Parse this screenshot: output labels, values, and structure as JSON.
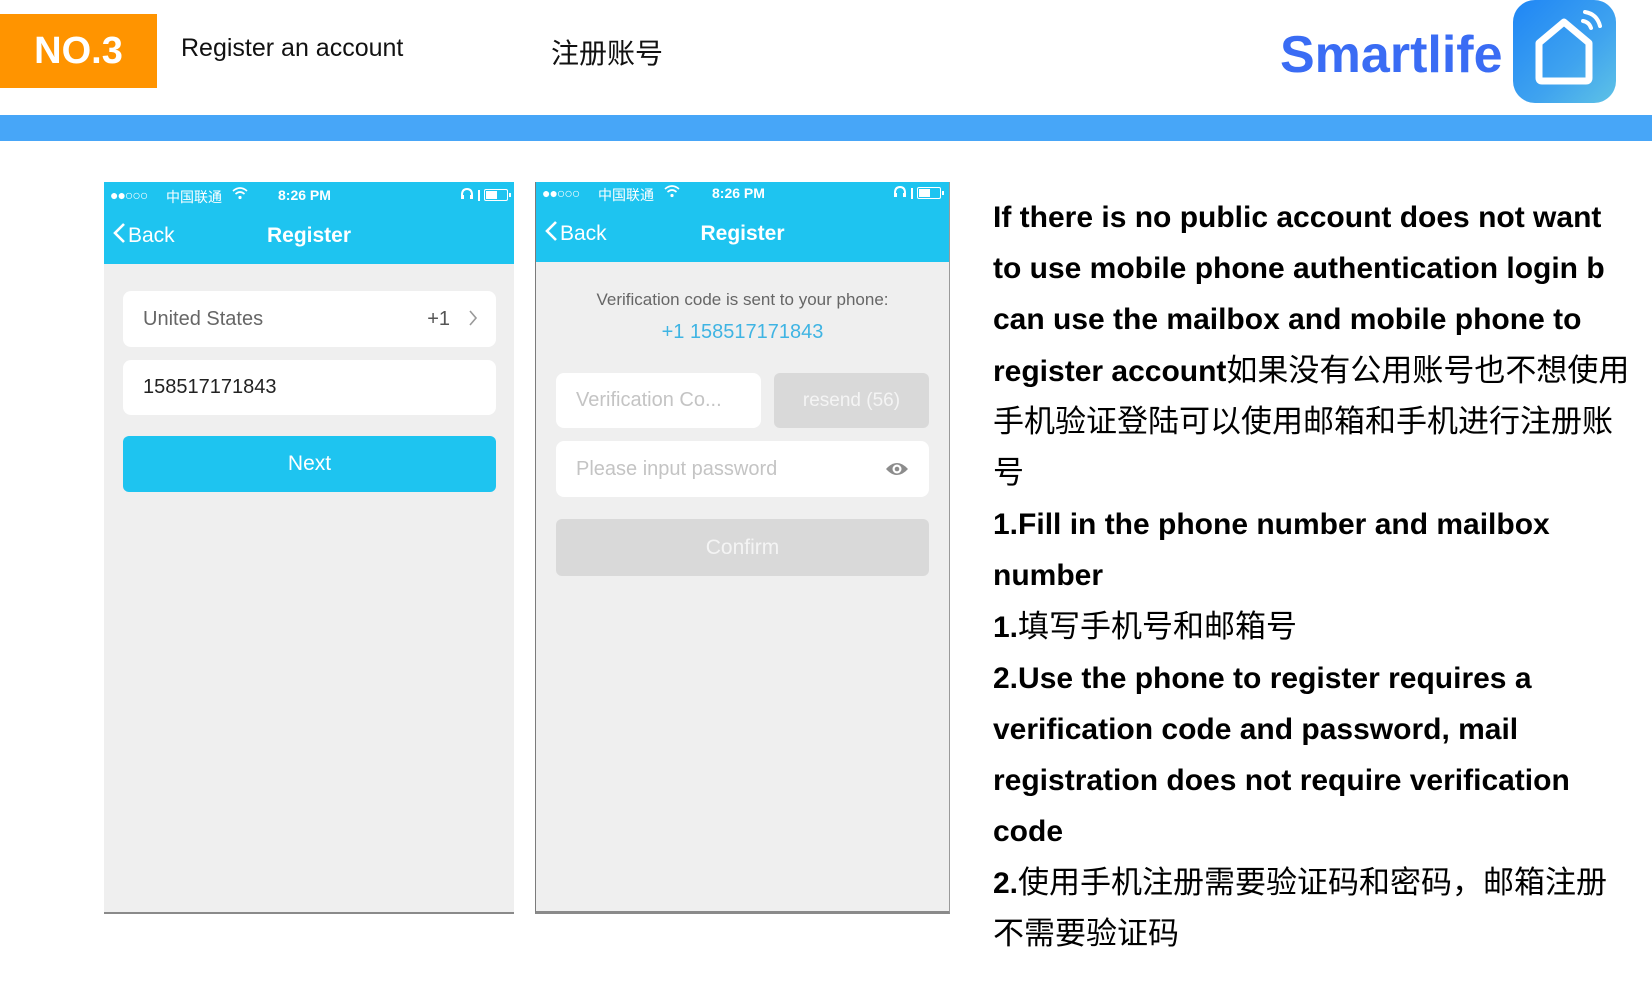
{
  "header": {
    "badge": "NO.3",
    "title_en": "Register an account",
    "title_zh": "注册账号",
    "brand": "Smartlife",
    "brand_color": "#3a6cf4",
    "badge_color": "#ff9400",
    "band_color": "#47a6f8",
    "logo_icon": "smart-home-house-wifi-icon"
  },
  "phone1": {
    "status": {
      "signal": "●●○○○",
      "carrier": "中国联通",
      "time": "8:26 PM"
    },
    "nav": {
      "back": "Back",
      "title": "Register"
    },
    "country": {
      "name": "United States",
      "code": "+1"
    },
    "phone_value": "158517171843",
    "next_button": "Next"
  },
  "phone2": {
    "status": {
      "signal": "●●○○○",
      "carrier": "中国联通",
      "time": "8:26 PM"
    },
    "nav": {
      "back": "Back",
      "title": "Register"
    },
    "info_text": "Verification code is sent to your phone:",
    "info_number": "+1 158517171843",
    "code_placeholder": "Verification Co...",
    "resend_button": "resend (56)",
    "password_placeholder": "Please input password",
    "confirm_button": "Confirm"
  },
  "instructions": {
    "intro_en": "If there is no public account does not want to use mobile phone authentication login b can use the mailbox and mobile phone to register account",
    "intro_zh": "如果没有公用账号也不想使用手机验证登陆可以使用邮箱和手机进行注册账号",
    "step1_num": "1.",
    "step1_en": "Fill in the phone number and mailbox number",
    "step1_zh": "填写手机号和邮箱号",
    "step2_num": "2.",
    "step2_en": "Use the phone to register requires a verification code and password, mail registration does not require verification code",
    "step2_zh": "使用手机注册需要验证码和密码，邮箱注册不需要验证码"
  }
}
